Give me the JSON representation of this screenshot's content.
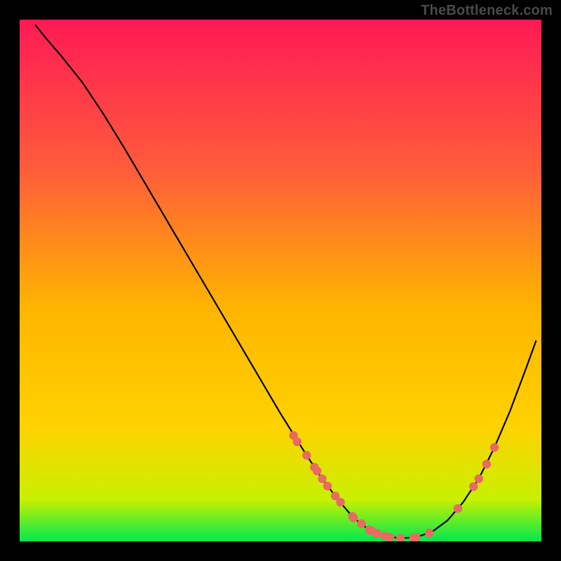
{
  "watermark": "TheBottleneck.com",
  "chart_data": {
    "type": "line",
    "title": "",
    "xlabel": "",
    "ylabel": "",
    "xlim": [
      0,
      100
    ],
    "ylim": [
      0,
      100
    ],
    "background_gradient": {
      "top": "#ff1a55",
      "mid": "#ffd200",
      "bottom": "#00e84f"
    },
    "curve": [
      {
        "x": 3.0,
        "y": 99.0
      },
      {
        "x": 5.0,
        "y": 96.5
      },
      {
        "x": 8.0,
        "y": 93.0
      },
      {
        "x": 12.0,
        "y": 88.0
      },
      {
        "x": 16.0,
        "y": 82.0
      },
      {
        "x": 20.0,
        "y": 75.5
      },
      {
        "x": 25.0,
        "y": 67.0
      },
      {
        "x": 30.0,
        "y": 58.5
      },
      {
        "x": 35.0,
        "y": 50.0
      },
      {
        "x": 40.0,
        "y": 41.5
      },
      {
        "x": 45.0,
        "y": 33.0
      },
      {
        "x": 50.0,
        "y": 24.5
      },
      {
        "x": 55.0,
        "y": 16.5
      },
      {
        "x": 58.0,
        "y": 12.0
      },
      {
        "x": 61.0,
        "y": 8.0
      },
      {
        "x": 64.0,
        "y": 4.5
      },
      {
        "x": 67.0,
        "y": 2.2
      },
      {
        "x": 70.0,
        "y": 1.0
      },
      {
        "x": 73.0,
        "y": 0.6
      },
      {
        "x": 76.0,
        "y": 0.8
      },
      {
        "x": 79.0,
        "y": 1.8
      },
      {
        "x": 82.0,
        "y": 4.0
      },
      {
        "x": 85.0,
        "y": 7.5
      },
      {
        "x": 88.0,
        "y": 12.0
      },
      {
        "x": 91.0,
        "y": 18.0
      },
      {
        "x": 94.0,
        "y": 25.0
      },
      {
        "x": 97.0,
        "y": 33.0
      },
      {
        "x": 99.0,
        "y": 38.5
      }
    ],
    "marker_points": [
      {
        "x": 52.5,
        "y": 20.3
      },
      {
        "x": 53.2,
        "y": 19.1
      },
      {
        "x": 55.0,
        "y": 16.5
      },
      {
        "x": 56.5,
        "y": 14.2
      },
      {
        "x": 57.0,
        "y": 13.5
      },
      {
        "x": 58.0,
        "y": 12.0
      },
      {
        "x": 59.0,
        "y": 10.6
      },
      {
        "x": 60.5,
        "y": 8.7
      },
      {
        "x": 61.5,
        "y": 7.5
      },
      {
        "x": 63.8,
        "y": 4.8
      },
      {
        "x": 64.0,
        "y": 4.5
      },
      {
        "x": 65.5,
        "y": 3.4
      },
      {
        "x": 67.0,
        "y": 2.2
      },
      {
        "x": 67.5,
        "y": 2.0
      },
      {
        "x": 68.5,
        "y": 1.5
      },
      {
        "x": 70.0,
        "y": 1.0
      },
      {
        "x": 71.0,
        "y": 0.8
      },
      {
        "x": 73.0,
        "y": 0.6
      },
      {
        "x": 75.5,
        "y": 0.7
      },
      {
        "x": 76.0,
        "y": 0.8
      },
      {
        "x": 78.5,
        "y": 1.6
      },
      {
        "x": 84.0,
        "y": 6.3
      },
      {
        "x": 87.0,
        "y": 10.5
      },
      {
        "x": 88.0,
        "y": 12.0
      },
      {
        "x": 89.5,
        "y": 14.8
      },
      {
        "x": 91.0,
        "y": 18.0
      }
    ],
    "marker_color": "#e86a62",
    "curve_color": "#000000"
  }
}
